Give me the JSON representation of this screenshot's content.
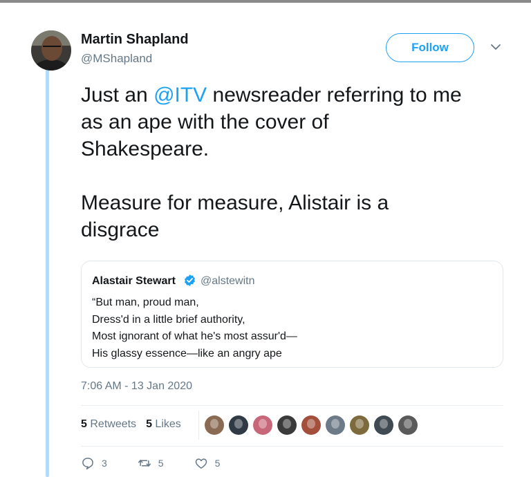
{
  "author": {
    "name": "Martin Shapland",
    "handle": "@MShapland"
  },
  "follow_label": "Follow",
  "tweet": {
    "part1": "Just an ",
    "mention": "@ITV",
    "part2": " newsreader referring to me\nas an ape with the cover of\nShakespeare.\n\nMeasure for measure, Alistair is a\ndisgrace"
  },
  "quoted": {
    "name": "Alastair Stewart",
    "handle": "@alstewitn",
    "lines": [
      "“But man, proud man,",
      "Dress'd in a little brief authority,",
      "Most ignorant of what he's most assur'd—",
      "His glassy essence—like an angry ape"
    ]
  },
  "timestamp": "7:06 AM - 13 Jan 2020",
  "stats": {
    "retweets_count": "5",
    "retweets_label": "Retweets",
    "likes_count": "5",
    "likes_label": "Likes"
  },
  "liker_avatars": [
    "#8a6a52",
    "#2f3a45",
    "#c8677a",
    "#3a3a3a",
    "#a34f3c",
    "#6d7a88",
    "#7d6a3d",
    "#3f4a52",
    "#5a5a5a"
  ],
  "actions": {
    "replies": "3",
    "retweets": "5",
    "likes": "5"
  },
  "colors": {
    "accent": "#1da1f2",
    "thread_line": "#b3dcf4",
    "secondary_text": "#657786"
  },
  "icons": [
    "chevron-down-icon",
    "verified-badge-icon",
    "reply-icon",
    "retweet-icon",
    "like-icon"
  ]
}
